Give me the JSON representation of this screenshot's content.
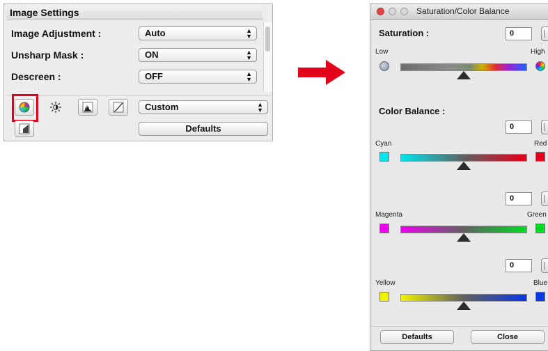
{
  "left_panel": {
    "title": "Image Settings",
    "rows": [
      {
        "label": "Image Adjustment :",
        "value": "Auto"
      },
      {
        "label": "Unsharp Mask :",
        "value": "ON"
      },
      {
        "label": "Descreen :",
        "value": "OFF"
      }
    ],
    "tone_select": "Custom",
    "defaults_label": "Defaults",
    "tools": [
      "saturation-color-balance-icon",
      "brightness-contrast-icon",
      "histogram-icon",
      "tone-curve-icon",
      "threshold-icon"
    ]
  },
  "arrow": {
    "color": "#e3001b"
  },
  "dialog": {
    "title": "Saturation/Color Balance",
    "saturation": {
      "label": "Saturation :",
      "value": "0",
      "low": "Low",
      "high": "High",
      "level": 0.5
    },
    "color_balance": {
      "label": "Color Balance :",
      "rows": [
        {
          "value": "0",
          "left": "Cyan",
          "right": "Red",
          "left_color": "#00e5ee",
          "right_color": "#e8001a",
          "level": 0.5
        },
        {
          "value": "0",
          "left": "Magenta",
          "right": "Green",
          "left_color": "#f000f0",
          "right_color": "#00dc22",
          "level": 0.5
        },
        {
          "value": "0",
          "left": "Yellow",
          "right": "Blue",
          "left_color": "#f2f200",
          "right_color": "#0a38e8",
          "level": 0.5
        }
      ]
    },
    "defaults_label": "Defaults",
    "close_label": "Close"
  }
}
